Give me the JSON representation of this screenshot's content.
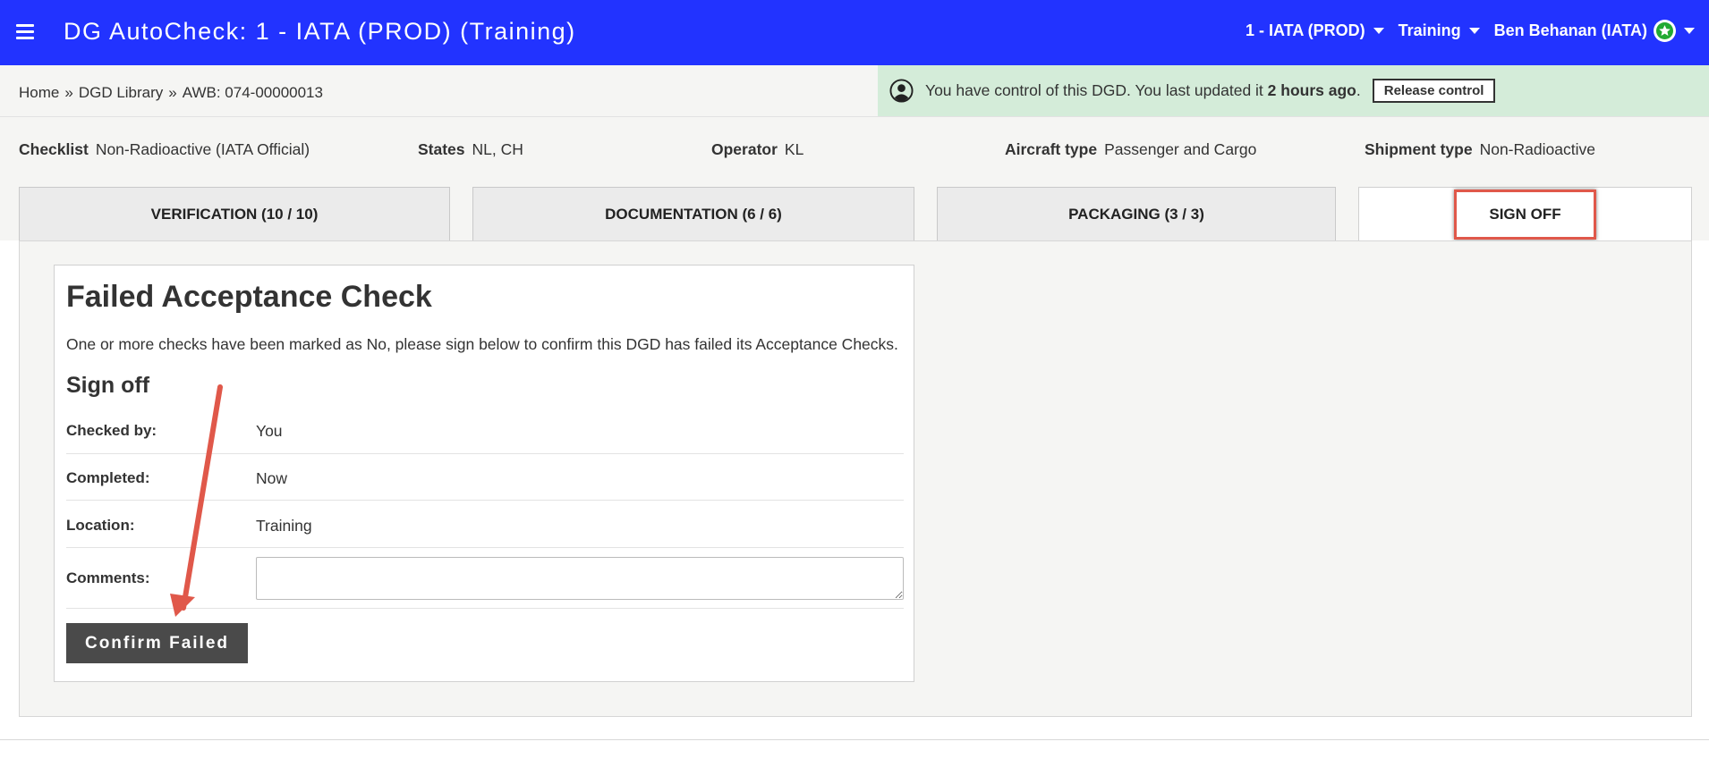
{
  "header": {
    "title": "DG AutoCheck: 1 - IATA (PROD) (Training)",
    "org_dropdown": "1 - IATA (PROD)",
    "location_dropdown": "Training",
    "user_name": "Ben Behanan (IATA)"
  },
  "breadcrumb": {
    "home": "Home",
    "sep1": "»",
    "library": "DGD Library",
    "sep2": "»",
    "current": "AWB: 074-00000013"
  },
  "control_banner": {
    "text_before": "You have control of this DGD. You last updated it ",
    "time": "2 hours ago",
    "text_after": ".",
    "release_label": "Release control"
  },
  "info": {
    "checklist_label": "Checklist",
    "checklist_value": "Non-Radioactive (IATA Official)",
    "states_label": "States",
    "states_value": "NL, CH",
    "operator_label": "Operator",
    "operator_value": "KL",
    "aircraft_label": "Aircraft type",
    "aircraft_value": "Passenger and Cargo",
    "shipment_label": "Shipment type",
    "shipment_value": "Non-Radioactive"
  },
  "tabs": [
    {
      "label": "VERIFICATION (10 / 10)"
    },
    {
      "label": "DOCUMENTATION (6 / 6)"
    },
    {
      "label": "PACKAGING (3 / 3)"
    },
    {
      "label": "SIGN OFF"
    }
  ],
  "signoff": {
    "title": "Failed Acceptance Check",
    "description": "One or more checks have been marked as No, please sign below to confirm this DGD has failed its Acceptance Checks.",
    "subtitle": "Sign off",
    "checked_by_label": "Checked by:",
    "checked_by_value": "You",
    "completed_label": "Completed:",
    "completed_value": "Now",
    "location_label": "Location:",
    "location_value": "Training",
    "comments_label": "Comments:",
    "comments_value": "",
    "confirm_label": "Confirm Failed"
  },
  "colors": {
    "header_bg": "#2233ff",
    "banner_bg": "#d4ecd9",
    "highlight": "#e0584a",
    "button_bg": "#4a4a4a",
    "user_badge_star": "#22aa33"
  },
  "icons": {
    "menu": "hamburger-icon",
    "dropdown": "caret-down-icon",
    "user_badge": "star-badge-icon",
    "control": "person-circle-icon"
  }
}
